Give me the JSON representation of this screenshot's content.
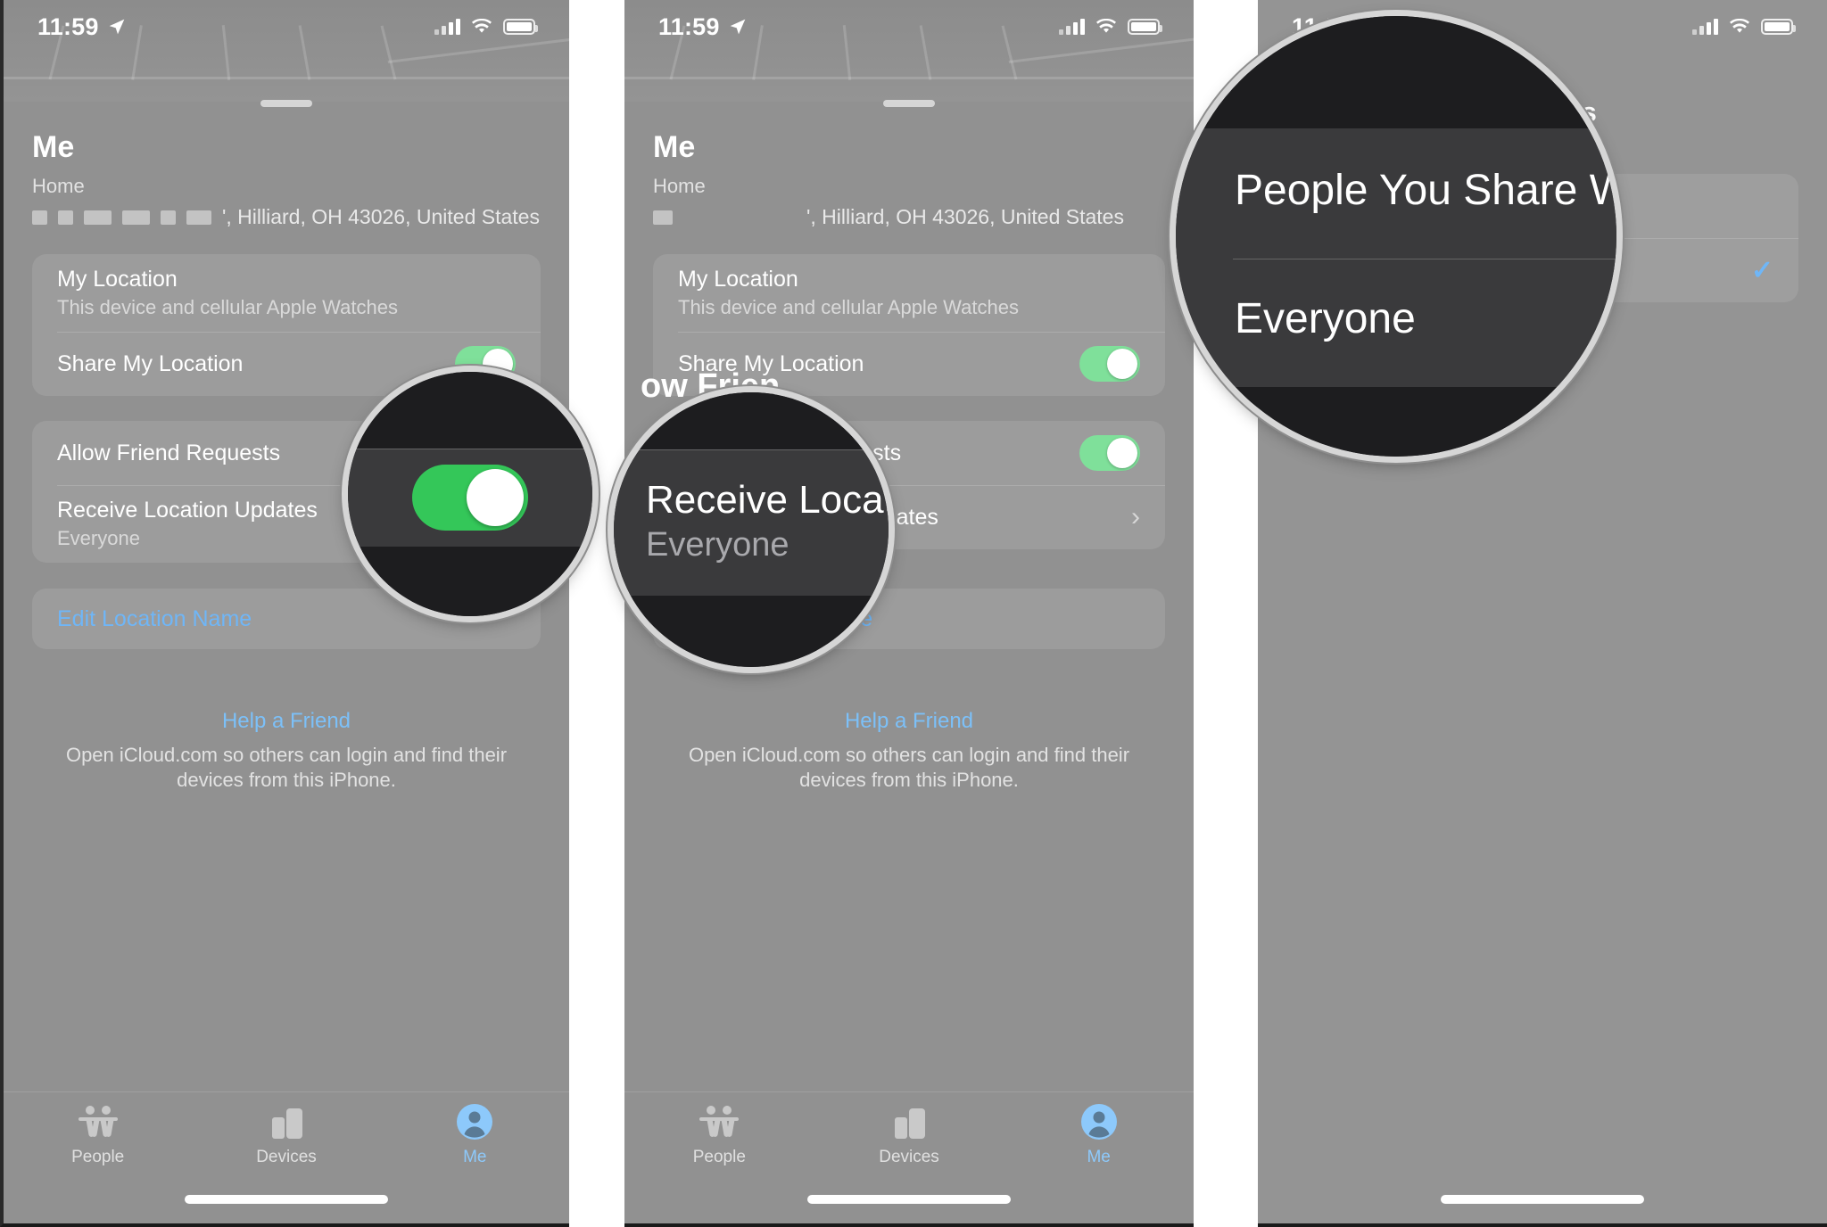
{
  "meta": {
    "accent_blue": "#6fb6f7",
    "toggle_green": "#34c759",
    "panel_gray": "#919191"
  },
  "status_bar": {
    "time": "11:59",
    "location_icon": "location-arrow-icon",
    "cellular": "cellular-bars-icon",
    "wifi": "wifi-icon",
    "battery": "battery-icon"
  },
  "panels": [
    {
      "title": "Me",
      "address": {
        "label": "Home",
        "text": "', Hilliard, OH  43026, United States"
      },
      "rows": {
        "my_location": {
          "title": "My Location",
          "sub": "This device and cellular Apple Watches"
        },
        "share_my_location": {
          "title": "Share My Location"
        },
        "allow_friend_requests": {
          "title": "Allow Friend Requests"
        },
        "receive_location_updates": {
          "title": "Receive Location Updates",
          "sub": "Everyone"
        },
        "edit_location_name": {
          "title": "Edit Location Name"
        }
      },
      "footer": {
        "link": "Help a Friend",
        "desc": "Open iCloud.com so others can login and find their devices from this iPhone."
      },
      "tabs": [
        {
          "label": "People",
          "icon": "people-icon",
          "active": false
        },
        {
          "label": "Devices",
          "icon": "devices-icon",
          "active": false
        },
        {
          "label": "Me",
          "icon": "person-circle-icon",
          "active": true
        }
      ],
      "loupe": {
        "content": "allow-friend-requests-toggle",
        "state": "on"
      }
    },
    {
      "title": "Me",
      "address": {
        "label": "Home",
        "text": "', Hilliard, OH  43026, United States"
      },
      "rows": {
        "my_location": {
          "title": "My Location",
          "sub": "This device and cellular Apple Watches"
        },
        "share_my_location": {
          "title": "Share My Location"
        },
        "allow_friend_requests": {
          "title": "Allow Friend Requests"
        },
        "receive_location_updates": {
          "title": "Receive Location Updates",
          "sub": "Everyone"
        },
        "edit_location_name": {
          "title": "Edit Location Name"
        }
      },
      "footer": {
        "link": "Help a Friend",
        "desc": "Open iCloud.com so others can login and find their devices from this iPhone."
      },
      "tabs": [
        {
          "label": "People",
          "icon": "people-icon",
          "active": false
        },
        {
          "label": "Devices",
          "icon": "devices-icon",
          "active": false
        },
        {
          "label": "Me",
          "icon": "person-circle-icon",
          "active": true
        }
      ],
      "loupe": {
        "title": "Receive Locatio",
        "sub": "Everyone"
      },
      "peek": {
        "partial_header": "ow Frien",
        "partial_row_suffix": "s",
        "partial_updates": "tes"
      }
    },
    {
      "header_partial": "n Updates",
      "options": [
        {
          "label": "People You Share With",
          "selected": false
        },
        {
          "label": "Everyone",
          "selected": true
        }
      ],
      "loupe": {
        "option_1": "People You Share Wit",
        "option_2": "Everyone"
      }
    }
  ]
}
